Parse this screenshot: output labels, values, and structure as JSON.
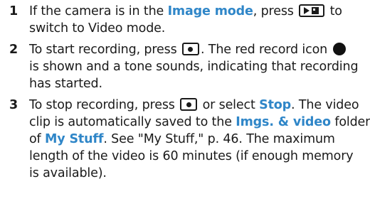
{
  "steps": [
    {
      "number": "1",
      "pre": "If the camera is in the ",
      "image_mode": "Image mode",
      "mid": ", press ",
      "mode_key_icon": "image-video-mode-key-icon",
      "post": " to",
      "line2": "switch to Video mode."
    },
    {
      "number": "2",
      "pre": "To start recording, press ",
      "capture_key_icon": "capture-key-icon",
      "mid": ". The red record icon ",
      "record_icon": "record-icon",
      "line2": "is shown and a tone sounds, indicating that recording",
      "line3": "has started."
    },
    {
      "number": "3",
      "pre": "To stop recording, press ",
      "capture_key_icon": "capture-key-icon",
      "or_select": " or select ",
      "stop": "Stop",
      "post": ". The video",
      "line2_pre": "clip is automatically saved to the ",
      "imgs_video": "Imgs. & video",
      "line2_post": " folder",
      "line3_pre": "of ",
      "my_stuff": "My Stuff",
      "line3_post": ". See \"My Stuff,\" p. 46. The maximum",
      "line4": "length of the video is 60 minutes (if enough memory",
      "line5": "is available)."
    }
  ],
  "colors": {
    "highlight": "#2f86c8",
    "text": "#1a1a1a"
  }
}
